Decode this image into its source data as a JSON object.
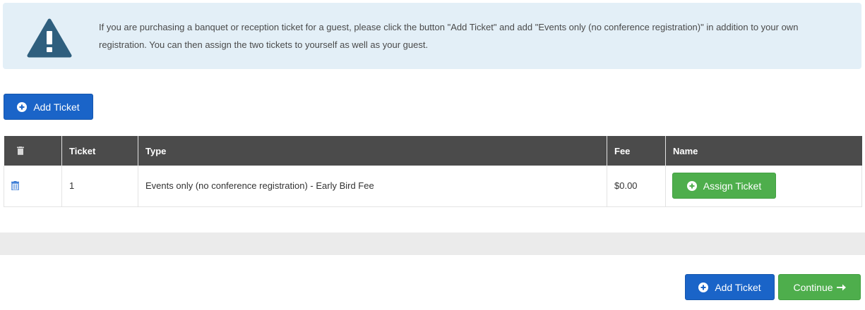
{
  "alert": {
    "icon": "warning-triangle-icon",
    "text": "If you are purchasing a banquet or reception ticket for a guest, please click the button \"Add Ticket\" and add \"Events only (no conference registration)\" in addition to your own registration. You can then assign the two tickets to yourself as well as your guest."
  },
  "top_add_button": {
    "label": "Add Ticket",
    "icon": "plus-circle-icon"
  },
  "table": {
    "header_icon": "trash-icon",
    "headers": {
      "ticket": "Ticket",
      "type": "Type",
      "fee": "Fee",
      "name": "Name"
    },
    "rows": [
      {
        "delete_icon": "trash-icon",
        "ticket": "1",
        "type": "Events only (no conference registration) - Early Bird Fee",
        "fee": "$0.00",
        "assign_label": "Assign Ticket"
      }
    ]
  },
  "footer": {
    "add_label": "Add Ticket",
    "continue_label": "Continue",
    "continue_icon": "arrow-right-icon"
  },
  "colors": {
    "alert_bg": "#e3eff7",
    "alert_icon": "#2f5f7e",
    "primary_blue": "#1a64c8",
    "success_green": "#4eae4c",
    "table_header": "#4b4b4b",
    "band_gray": "#ebebeb"
  }
}
